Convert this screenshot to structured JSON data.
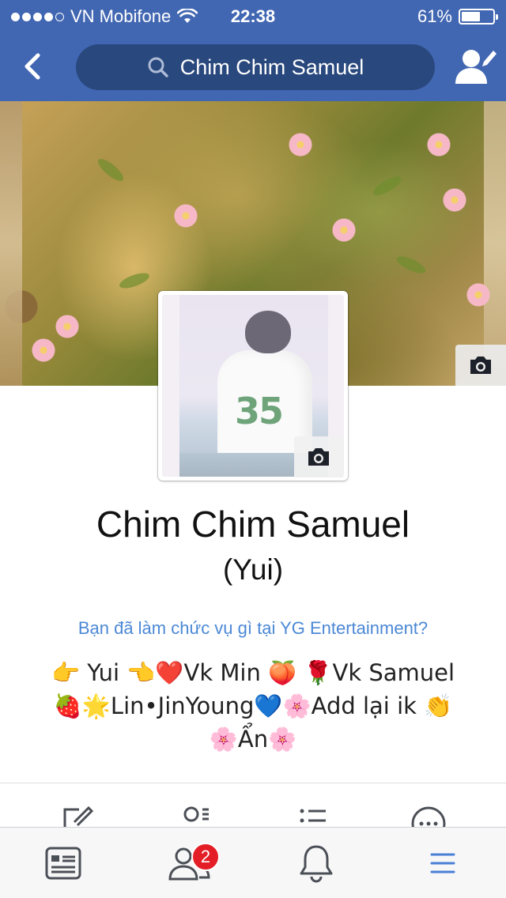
{
  "status_bar": {
    "carrier": "VN Mobifone",
    "time": "22:38",
    "battery_percent": "61%",
    "battery_level": 0.61,
    "signal_bars": 4
  },
  "header": {
    "search_text": "Chim Chim Samuel"
  },
  "profile": {
    "name": "Chim Chim Samuel",
    "alternate_name": "(Yui)",
    "job_prompt": "Bạn đã làm chức vụ gì tại YG Entertainment?",
    "bio_lines": [
      "👉 Yui 👈❤️Vk Min 🍑 🌹Vk Samuel",
      "🍓🌟Lin•JinYoung💙🌸Add lại ik 👏",
      "🌸Ẩn🌸"
    ],
    "avatar_jersey_number": "35"
  },
  "bottom_nav": {
    "friend_requests_badge": "2",
    "active_tab": "menu"
  },
  "colors": {
    "brand": "#4267b2",
    "search_pill": "#29487d",
    "link": "#4b88d6",
    "badge": "#e41e26",
    "menu_active": "#4a7fd6"
  },
  "icons": {
    "back": "chevron-left-icon",
    "search": "search-icon",
    "friend": "add-friend-icon",
    "camera": "camera-icon",
    "news_feed": "news-feed-icon",
    "friends": "friends-icon",
    "notifications": "bell-icon",
    "menu": "hamburger-menu-icon"
  }
}
